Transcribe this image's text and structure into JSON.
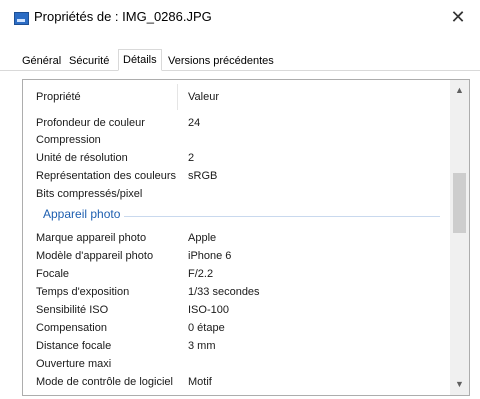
{
  "window": {
    "title": "Propriétés de : IMG_0286.JPG",
    "close_glyph": "✕"
  },
  "tabs": [
    {
      "label": "Général"
    },
    {
      "label": "Sécurité"
    },
    {
      "label": "Détails",
      "active": true
    },
    {
      "label": "Versions précédentes"
    }
  ],
  "table": {
    "header": {
      "property": "Propriété",
      "value": "Valeur"
    },
    "rows_top": [
      {
        "property": "Profondeur de couleur",
        "value": "24"
      },
      {
        "property": "Compression",
        "value": ""
      },
      {
        "property": "Unité de résolution",
        "value": "2"
      },
      {
        "property": "Représentation des couleurs",
        "value": "sRGB"
      },
      {
        "property": "Bits compressés/pixel",
        "value": ""
      }
    ],
    "group": "Appareil photo",
    "rows_camera": [
      {
        "property": "Marque appareil photo",
        "value": "Apple"
      },
      {
        "property": "Modèle d'appareil photo",
        "value": "iPhone 6"
      },
      {
        "property": "Focale",
        "value": "F/2.2"
      },
      {
        "property": "Temps d'exposition",
        "value": "1/33 secondes"
      },
      {
        "property": "Sensibilité ISO",
        "value": "ISO-100"
      },
      {
        "property": "Compensation",
        "value": "0 étape"
      },
      {
        "property": "Distance focale",
        "value": "3 mm"
      },
      {
        "property": "Ouverture maxi",
        "value": ""
      },
      {
        "property": "Mode de contrôle de logiciel",
        "value": "Motif"
      }
    ]
  },
  "scrollbar": {
    "up_glyph": "▲",
    "down_glyph": "▼"
  }
}
